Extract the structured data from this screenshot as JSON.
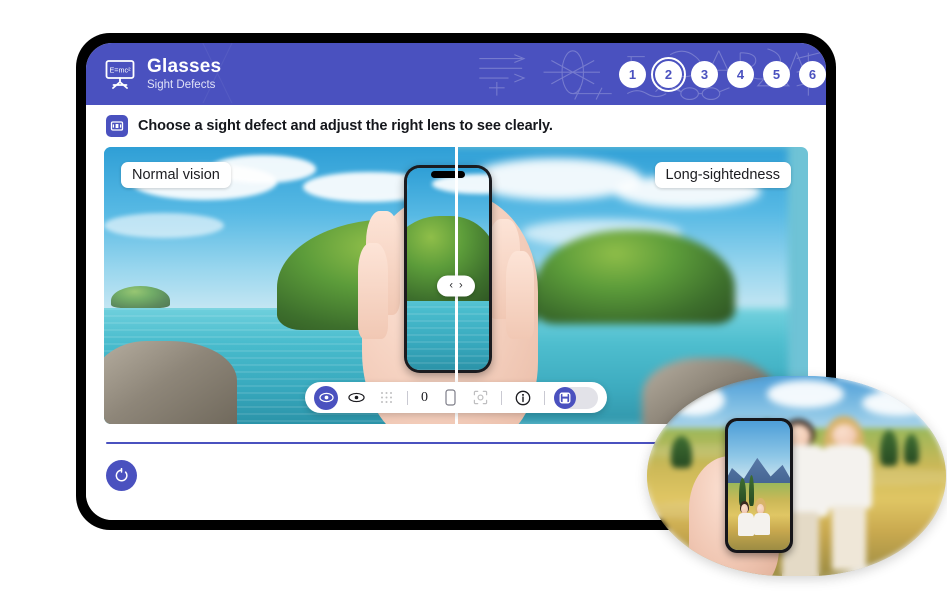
{
  "header": {
    "title": "Glasses",
    "subtitle": "Sight Defects",
    "board_icon": "blackboard-icon",
    "board_text": "E=mc²",
    "pattern": "physics-formula-pattern",
    "steps": [
      {
        "label": "1",
        "active": false
      },
      {
        "label": "2",
        "active": true
      },
      {
        "label": "3",
        "active": false
      },
      {
        "label": "4",
        "active": false
      },
      {
        "label": "5",
        "active": false
      },
      {
        "label": "6",
        "active": false
      }
    ]
  },
  "instruction": {
    "badge_icon": "card-id-icon",
    "text": "Choose a sight defect and adjust the right lens to see clearly."
  },
  "viewer": {
    "left_label": "Normal vision",
    "right_label": "Long-sightedness",
    "handle_left_icon": "chevron-left-icon",
    "handle_right_icon": "chevron-right-icon",
    "chevron_left": "‹",
    "chevron_right": "›",
    "left_state": "sharp",
    "right_state": "blurred"
  },
  "toolbar": {
    "items": [
      {
        "name": "eye-normal-button",
        "icon": "eye-open-icon",
        "state": "active"
      },
      {
        "name": "eye-defect-button",
        "icon": "eye-outline-icon",
        "state": "default"
      },
      {
        "name": "grid-button",
        "icon": "grid-dots-icon",
        "state": "disabled"
      },
      {
        "name": "divider-1",
        "icon": "divider",
        "state": "static"
      },
      {
        "name": "diopter-value",
        "icon": "text-value",
        "state": "default"
      },
      {
        "name": "lens-button",
        "icon": "lens-icon",
        "state": "default"
      },
      {
        "name": "focus-button",
        "icon": "focus-target-icon",
        "state": "disabled"
      },
      {
        "name": "divider-2",
        "icon": "divider",
        "state": "static"
      },
      {
        "name": "info-button",
        "icon": "info-circle-icon",
        "state": "default"
      },
      {
        "name": "divider-3",
        "icon": "divider",
        "state": "static"
      },
      {
        "name": "compare-toggle",
        "icon": "compare-icon",
        "state": "on"
      }
    ],
    "diopter": "0",
    "toggle_state": "on",
    "toggle_icon": "compare-split-icon"
  },
  "footer": {
    "reset_icon": "reset-circular-arrow-icon",
    "reset_label": "Reset"
  },
  "lens_overlay": {
    "alt": "long-sightedness-preview",
    "scene": "couple-in-wheat-field-with-phone"
  },
  "colors": {
    "brand": "#4a51bf",
    "header_bg": "#4a51bf",
    "frame": "#000000",
    "screen": "#ffffff",
    "text": "#15171c",
    "divider": "#4a51bf"
  }
}
